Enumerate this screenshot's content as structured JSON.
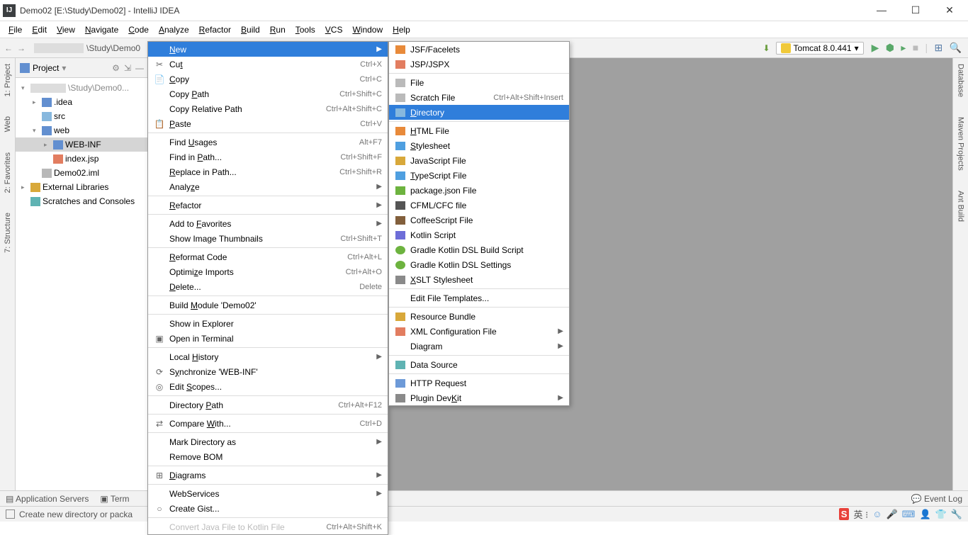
{
  "title": "Demo02 [E:\\Study\\Demo02] - IntelliJ IDEA",
  "menubar": [
    "File",
    "Edit",
    "View",
    "Navigate",
    "Code",
    "Analyze",
    "Refactor",
    "Build",
    "Run",
    "Tools",
    "VCS",
    "Window",
    "Help"
  ],
  "menubar_u": [
    "F",
    "E",
    "V",
    "N",
    "C",
    "A",
    "R",
    "B",
    "R",
    "T",
    "V",
    "W",
    "H"
  ],
  "breadcrumbs": {
    "path_tail": "\\Study\\Demo0"
  },
  "tomcat": "Tomcat 8.0.441",
  "project_header": "Project",
  "tree": {
    "root_path": "\\Study\\Demo0...",
    "items": [
      {
        "indent": 1,
        "arrow": ">",
        "icon": "folder-icon",
        "label": ".idea"
      },
      {
        "indent": 1,
        "arrow": "",
        "icon": "folder-blue",
        "label": "src"
      },
      {
        "indent": 1,
        "arrow": "v",
        "icon": "folder-icon",
        "label": "web"
      },
      {
        "indent": 2,
        "arrow": ">",
        "icon": "folder-icon",
        "label": "WEB-INF",
        "sel": true
      },
      {
        "indent": 2,
        "arrow": "",
        "icon": "jsp-icon",
        "label": "index.jsp"
      },
      {
        "indent": 1,
        "arrow": "",
        "icon": "file-icon",
        "label": "Demo02.iml"
      }
    ],
    "ext_lib": "External Libraries",
    "scratches": "Scratches and Consoles"
  },
  "left_tabs": [
    "1: Project",
    "Web",
    "2: Favorites",
    "7: Structure"
  ],
  "right_tabs": [
    "Database",
    "Maven Projects",
    "Ant Build"
  ],
  "bottom1": {
    "app_servers": "Application Servers",
    "terminal": "Term",
    "event_log": "Event Log"
  },
  "bottom2": {
    "status": "Create new directory or packa"
  },
  "context1": [
    {
      "type": "row",
      "icon": "",
      "label": "New",
      "shortcut": "",
      "sub": true,
      "sel": true,
      "u": "N"
    },
    {
      "type": "row",
      "icon": "✂",
      "label": "Cut",
      "shortcut": "Ctrl+X",
      "u": "t"
    },
    {
      "type": "row",
      "icon": "📄",
      "label": "Copy",
      "shortcut": "Ctrl+C",
      "u": "C"
    },
    {
      "type": "row",
      "icon": "",
      "label": "Copy Path",
      "shortcut": "Ctrl+Shift+C",
      "u": "P"
    },
    {
      "type": "row",
      "icon": "",
      "label": "Copy Relative Path",
      "shortcut": "Ctrl+Alt+Shift+C"
    },
    {
      "type": "row",
      "icon": "📋",
      "label": "Paste",
      "shortcut": "Ctrl+V",
      "u": "P"
    },
    {
      "type": "sep"
    },
    {
      "type": "row",
      "icon": "",
      "label": "Find Usages",
      "shortcut": "Alt+F7",
      "u": "U"
    },
    {
      "type": "row",
      "icon": "",
      "label": "Find in Path...",
      "shortcut": "Ctrl+Shift+F",
      "u": "P"
    },
    {
      "type": "row",
      "icon": "",
      "label": "Replace in Path...",
      "shortcut": "Ctrl+Shift+R",
      "u": "R"
    },
    {
      "type": "row",
      "icon": "",
      "label": "Analyze",
      "shortcut": "",
      "sub": true,
      "u": "z"
    },
    {
      "type": "sep"
    },
    {
      "type": "row",
      "icon": "",
      "label": "Refactor",
      "shortcut": "",
      "sub": true,
      "u": "R"
    },
    {
      "type": "sep"
    },
    {
      "type": "row",
      "icon": "",
      "label": "Add to Favorites",
      "shortcut": "",
      "sub": true,
      "u": "F"
    },
    {
      "type": "row",
      "icon": "",
      "label": "Show Image Thumbnails",
      "shortcut": "Ctrl+Shift+T"
    },
    {
      "type": "sep"
    },
    {
      "type": "row",
      "icon": "",
      "label": "Reformat Code",
      "shortcut": "Ctrl+Alt+L",
      "u": "R"
    },
    {
      "type": "row",
      "icon": "",
      "label": "Optimize Imports",
      "shortcut": "Ctrl+Alt+O",
      "u": "z"
    },
    {
      "type": "row",
      "icon": "",
      "label": "Delete...",
      "shortcut": "Delete",
      "u": "D"
    },
    {
      "type": "sep"
    },
    {
      "type": "row",
      "icon": "",
      "label": "Build Module 'Demo02'",
      "u": "M"
    },
    {
      "type": "sep"
    },
    {
      "type": "row",
      "icon": "",
      "label": "Show in Explorer"
    },
    {
      "type": "row",
      "icon": "▣",
      "label": "Open in Terminal"
    },
    {
      "type": "sep"
    },
    {
      "type": "row",
      "icon": "",
      "label": "Local History",
      "shortcut": "",
      "sub": true,
      "u": "H"
    },
    {
      "type": "row",
      "icon": "⟳",
      "label": "Synchronize 'WEB-INF'",
      "u": "y"
    },
    {
      "type": "row",
      "icon": "◎",
      "label": "Edit Scopes...",
      "u": "S"
    },
    {
      "type": "sep"
    },
    {
      "type": "row",
      "icon": "",
      "label": "Directory Path",
      "shortcut": "Ctrl+Alt+F12",
      "u": "P"
    },
    {
      "type": "sep"
    },
    {
      "type": "row",
      "icon": "⇄",
      "label": "Compare With...",
      "shortcut": "Ctrl+D",
      "u": "W"
    },
    {
      "type": "sep"
    },
    {
      "type": "row",
      "icon": "",
      "label": "Mark Directory as",
      "shortcut": "",
      "sub": true
    },
    {
      "type": "row",
      "icon": "",
      "label": "Remove BOM"
    },
    {
      "type": "sep"
    },
    {
      "type": "row",
      "icon": "⊞",
      "label": "Diagrams",
      "shortcut": "",
      "sub": true,
      "u": "D"
    },
    {
      "type": "sep"
    },
    {
      "type": "row",
      "icon": "",
      "label": "WebServices",
      "shortcut": "",
      "sub": true
    },
    {
      "type": "row",
      "icon": "○",
      "label": "Create Gist..."
    },
    {
      "type": "sep"
    },
    {
      "type": "row",
      "icon": "",
      "label": "Convert Java File to Kotlin File",
      "shortcut": "Ctrl+Alt+Shift+K",
      "dis": true
    }
  ],
  "context2": [
    {
      "icon": "ic-h",
      "label": "JSF/Facelets"
    },
    {
      "icon": "ic-jsp",
      "label": "JSP/JSPX"
    },
    {
      "type": "sep"
    },
    {
      "icon": "ic-file",
      "label": "File"
    },
    {
      "icon": "ic-file",
      "label": "Scratch File",
      "shortcut": "Ctrl+Alt+Shift+Insert"
    },
    {
      "icon": "ic-dir",
      "label": "Directory",
      "sel": true,
      "u": "D"
    },
    {
      "type": "sep"
    },
    {
      "icon": "ic-h",
      "label": "HTML File",
      "u": "H"
    },
    {
      "icon": "ic-css",
      "label": "Stylesheet",
      "u": "S"
    },
    {
      "icon": "ic-js",
      "label": "JavaScript File"
    },
    {
      "icon": "ic-ts",
      "label": "TypeScript File",
      "u": "T"
    },
    {
      "icon": "ic-json",
      "label": "package.json File"
    },
    {
      "icon": "ic-cfml",
      "label": "CFML/CFC file"
    },
    {
      "icon": "ic-coffee",
      "label": "CoffeeScript File"
    },
    {
      "icon": "ic-kt",
      "label": "Kotlin Script"
    },
    {
      "icon": "ic-gradle",
      "label": "Gradle Kotlin DSL Build Script"
    },
    {
      "icon": "ic-gradle",
      "label": "Gradle Kotlin DSL Settings"
    },
    {
      "icon": "ic-xslt",
      "label": "XSLT Stylesheet",
      "u": "X"
    },
    {
      "type": "sep"
    },
    {
      "icon": "",
      "label": "Edit File Templates..."
    },
    {
      "type": "sep"
    },
    {
      "icon": "ic-rb",
      "label": "Resource Bundle"
    },
    {
      "icon": "ic-xml",
      "label": "XML Configuration File",
      "sub": true
    },
    {
      "icon": "",
      "label": "Diagram",
      "sub": true
    },
    {
      "type": "sep"
    },
    {
      "icon": "ic-db",
      "label": "Data Source"
    },
    {
      "type": "sep"
    },
    {
      "icon": "ic-api",
      "label": "HTTP Request"
    },
    {
      "icon": "ic-plugin",
      "label": "Plugin DevKit",
      "sub": true,
      "u": "K"
    }
  ]
}
